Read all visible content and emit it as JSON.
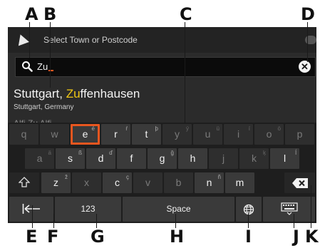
{
  "callouts": [
    "A",
    "B",
    "C",
    "D",
    "E",
    "F",
    "G",
    "H",
    "I",
    "J",
    "K"
  ],
  "titlebar": {
    "title": "Select Town or Postcode",
    "nav_icon": "navigation-arrow-icon"
  },
  "search": {
    "value": "Zu",
    "search_icon": "search-icon",
    "clear_icon": "close-circle-icon",
    "clear_glyph": "✕"
  },
  "result": {
    "title_prefix": "Stuttgart, ",
    "title_highlight": "Zu",
    "title_suffix": "ffenhausen",
    "subtitle": "Stuttgart, Germany"
  },
  "next_result_partial": "Alfi     Zu   Alfi",
  "keyboard": {
    "row1": [
      {
        "label": "q",
        "sup": "",
        "enabled": false
      },
      {
        "label": "w",
        "sup": "",
        "enabled": false
      },
      {
        "label": "e",
        "sup": "é",
        "enabled": true,
        "focused": true
      },
      {
        "label": "r",
        "sup": "ŕ",
        "enabled": true
      },
      {
        "label": "t",
        "sup": "þ",
        "enabled": true
      },
      {
        "label": "y",
        "sup": "ý",
        "enabled": false
      },
      {
        "label": "u",
        "sup": "ü",
        "enabled": false
      },
      {
        "label": "i",
        "sup": "í",
        "enabled": false
      },
      {
        "label": "o",
        "sup": "ö",
        "enabled": false
      },
      {
        "label": "p",
        "sup": "",
        "enabled": false
      }
    ],
    "row2": [
      {
        "label": "a",
        "sup": "ä",
        "enabled": false
      },
      {
        "label": "s",
        "sup": "ß",
        "enabled": true
      },
      {
        "label": "d",
        "sup": "ď",
        "enabled": true
      },
      {
        "label": "f",
        "sup": "",
        "enabled": true
      },
      {
        "label": "g",
        "sup": "ğ",
        "enabled": true
      },
      {
        "label": "h",
        "sup": "",
        "enabled": true
      },
      {
        "label": "j",
        "sup": "",
        "enabled": false
      },
      {
        "label": "k",
        "sup": "ķ",
        "enabled": false
      },
      {
        "label": "l",
        "sup": "ĺ",
        "enabled": true
      }
    ],
    "row3": [
      {
        "label": "z",
        "sup": "ž",
        "enabled": true
      },
      {
        "label": "x",
        "sup": "",
        "enabled": false
      },
      {
        "label": "c",
        "sup": "ç",
        "enabled": true
      },
      {
        "label": "v",
        "sup": "",
        "enabled": false
      },
      {
        "label": "b",
        "sup": "",
        "enabled": false
      },
      {
        "label": "n",
        "sup": "ñ",
        "enabled": true
      },
      {
        "label": "m",
        "sup": "",
        "enabled": true
      }
    ],
    "shift_icon": "shift-arrow-icon",
    "backspace_icon": "backspace-icon",
    "back_icon": "back-arrow-icon",
    "numbers_label": "123",
    "space_label": "Space",
    "globe_icon": "globe-icon",
    "hide_keyboard_icon": "keyboard-hide-icon"
  },
  "colors": {
    "accent_orange": "#e8561f",
    "highlight_yellow": "#f2c814",
    "screen_bg": "#2b2b2b"
  }
}
